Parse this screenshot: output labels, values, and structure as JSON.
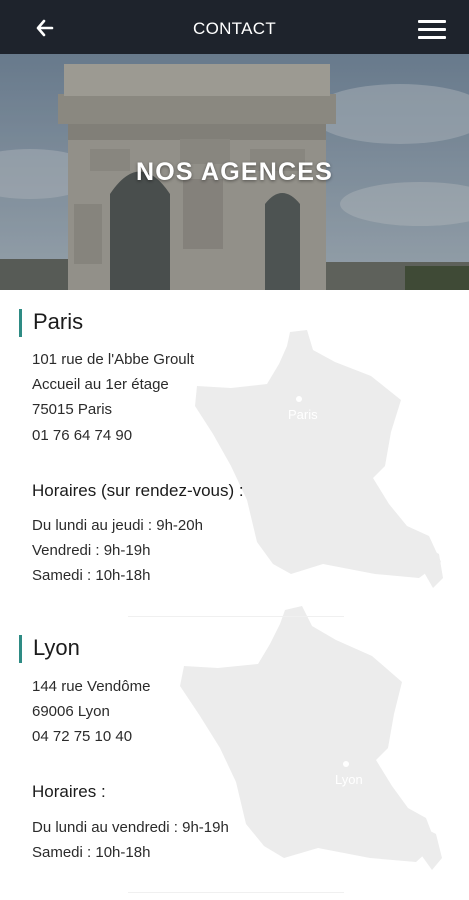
{
  "header": {
    "title": "CONTACT",
    "back_icon": "arrow-left-icon",
    "menu_icon": "hamburger-menu-icon"
  },
  "hero": {
    "title": "NOS AGENCES"
  },
  "agencies": [
    {
      "name": "Paris",
      "address": [
        "101 rue de l'Abbe Groult",
        "Accueil au 1er étage",
        "75015 Paris"
      ],
      "phone": "01 76 64 74 90",
      "hours_title": "Horaires (sur rendez-vous) :",
      "hours": [
        "Du lundi au jeudi : 9h-20h",
        "Vendredi : 9h-19h",
        "Samedi : 10h-18h"
      ],
      "map_label": "Paris"
    },
    {
      "name": "Lyon",
      "address": [
        "144 rue Vendôme",
        "69006 Lyon"
      ],
      "phone": "04 72 75 10 40",
      "hours_title": "Horaires :",
      "hours": [
        "Du lundi au vendredi : 9h-19h",
        "Samedi : 10h-18h"
      ],
      "map_label": "Lyon"
    }
  ],
  "colors": {
    "topbar": "#1e232c",
    "accent": "#2e8b84",
    "map": "#ececec"
  }
}
